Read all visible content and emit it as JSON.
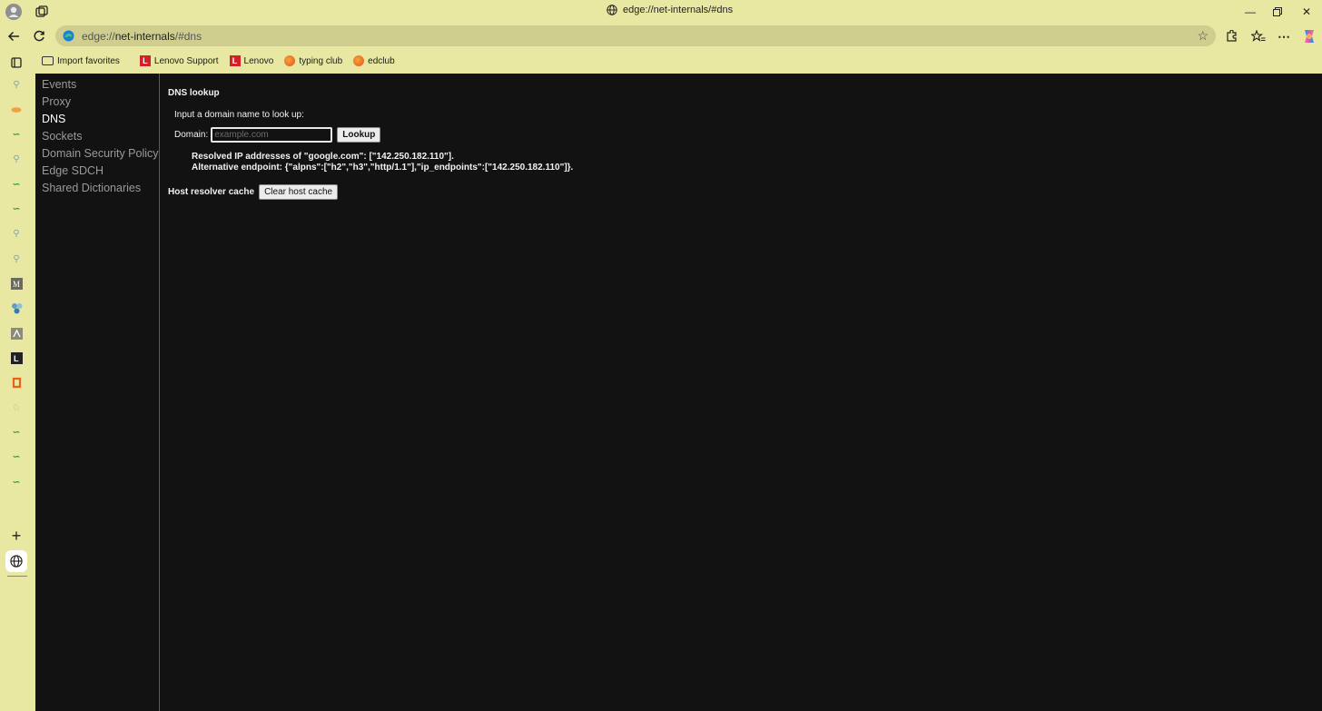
{
  "titlebar": {
    "title": "edge://net-internals/#dns",
    "icons": [
      "profile-icon",
      "workspaces-icon",
      "globe-icon"
    ],
    "window_controls": [
      "minimize",
      "maximize",
      "close"
    ]
  },
  "address_bar": {
    "prefix": "edge://",
    "host": "net-internals",
    "suffix": "/#dns"
  },
  "favorites": [
    {
      "label": "Import favorites",
      "icon": "folder-icon"
    },
    {
      "label": "Lenovo Support",
      "icon": "lenovo-l-icon"
    },
    {
      "label": "Lenovo",
      "icon": "lenovo-l-icon"
    },
    {
      "label": "typing club",
      "icon": "typing-club-icon"
    },
    {
      "label": "edclub",
      "icon": "edclub-icon"
    }
  ],
  "nav": {
    "items": [
      {
        "label": "Events"
      },
      {
        "label": "Proxy"
      },
      {
        "label": "DNS",
        "active": true
      },
      {
        "label": "Sockets"
      },
      {
        "label": "Domain Security Policy"
      },
      {
        "label": "Edge SDCH"
      },
      {
        "label": "Shared Dictionaries"
      }
    ]
  },
  "dns": {
    "heading": "DNS lookup",
    "prompt": "Input a domain name to look up:",
    "domain_label": "Domain:",
    "domain_placeholder": "example.com",
    "lookup_button": "Lookup",
    "result_line1": "Resolved IP addresses of \"google.com\": [\"142.250.182.110\"].",
    "result_line2": "Alternative endpoint: {\"alpns\":[\"h2\",\"h3\",\"http/1.1\"],\"ip_endpoints\":[\"142.250.182.110\"]}.",
    "cache_label": "Host resolver cache",
    "clear_button": "Clear host cache"
  },
  "colors": {
    "chrome_bg": "#e9e8a3",
    "page_bg": "#121212",
    "nav_inactive": "#9a9a9a",
    "nav_active": "#ffffff"
  }
}
